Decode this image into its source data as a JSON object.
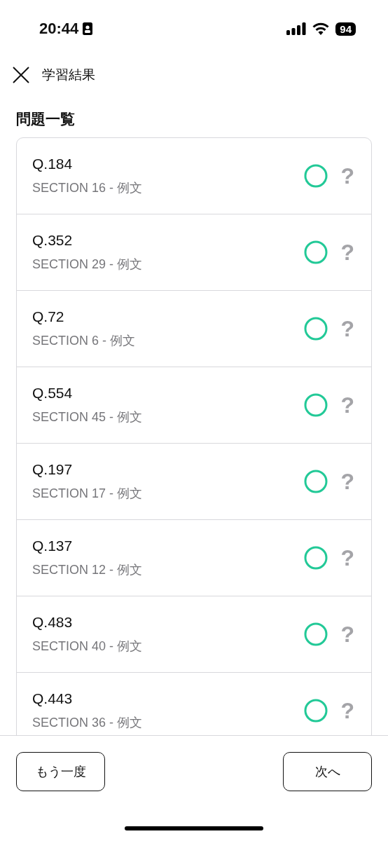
{
  "status_bar": {
    "time": "20:44",
    "battery": "94"
  },
  "header": {
    "title": "学習結果"
  },
  "section_title": "問題一覧",
  "questions": [
    {
      "number": "Q.184",
      "section": "SECTION 16 - 例文",
      "kind": "correct",
      "help": "?"
    },
    {
      "number": "Q.352",
      "section": "SECTION 29 - 例文",
      "kind": "correct",
      "help": "?"
    },
    {
      "number": "Q.72",
      "section": "SECTION 6 - 例文",
      "kind": "correct",
      "help": "?"
    },
    {
      "number": "Q.554",
      "section": "SECTION 45 - 例文",
      "kind": "correct",
      "help": "?"
    },
    {
      "number": "Q.197",
      "section": "SECTION 17 - 例文",
      "kind": "correct",
      "help": "?"
    },
    {
      "number": "Q.137",
      "section": "SECTION 12 - 例文",
      "kind": "correct",
      "help": "?"
    },
    {
      "number": "Q.483",
      "section": "SECTION 40 - 例文",
      "kind": "correct",
      "help": "?"
    },
    {
      "number": "Q.443",
      "section": "SECTION 36 - 例文",
      "kind": "correct",
      "help": "?"
    }
  ],
  "buttons": [
    "もう一度",
    "次へ"
  ]
}
